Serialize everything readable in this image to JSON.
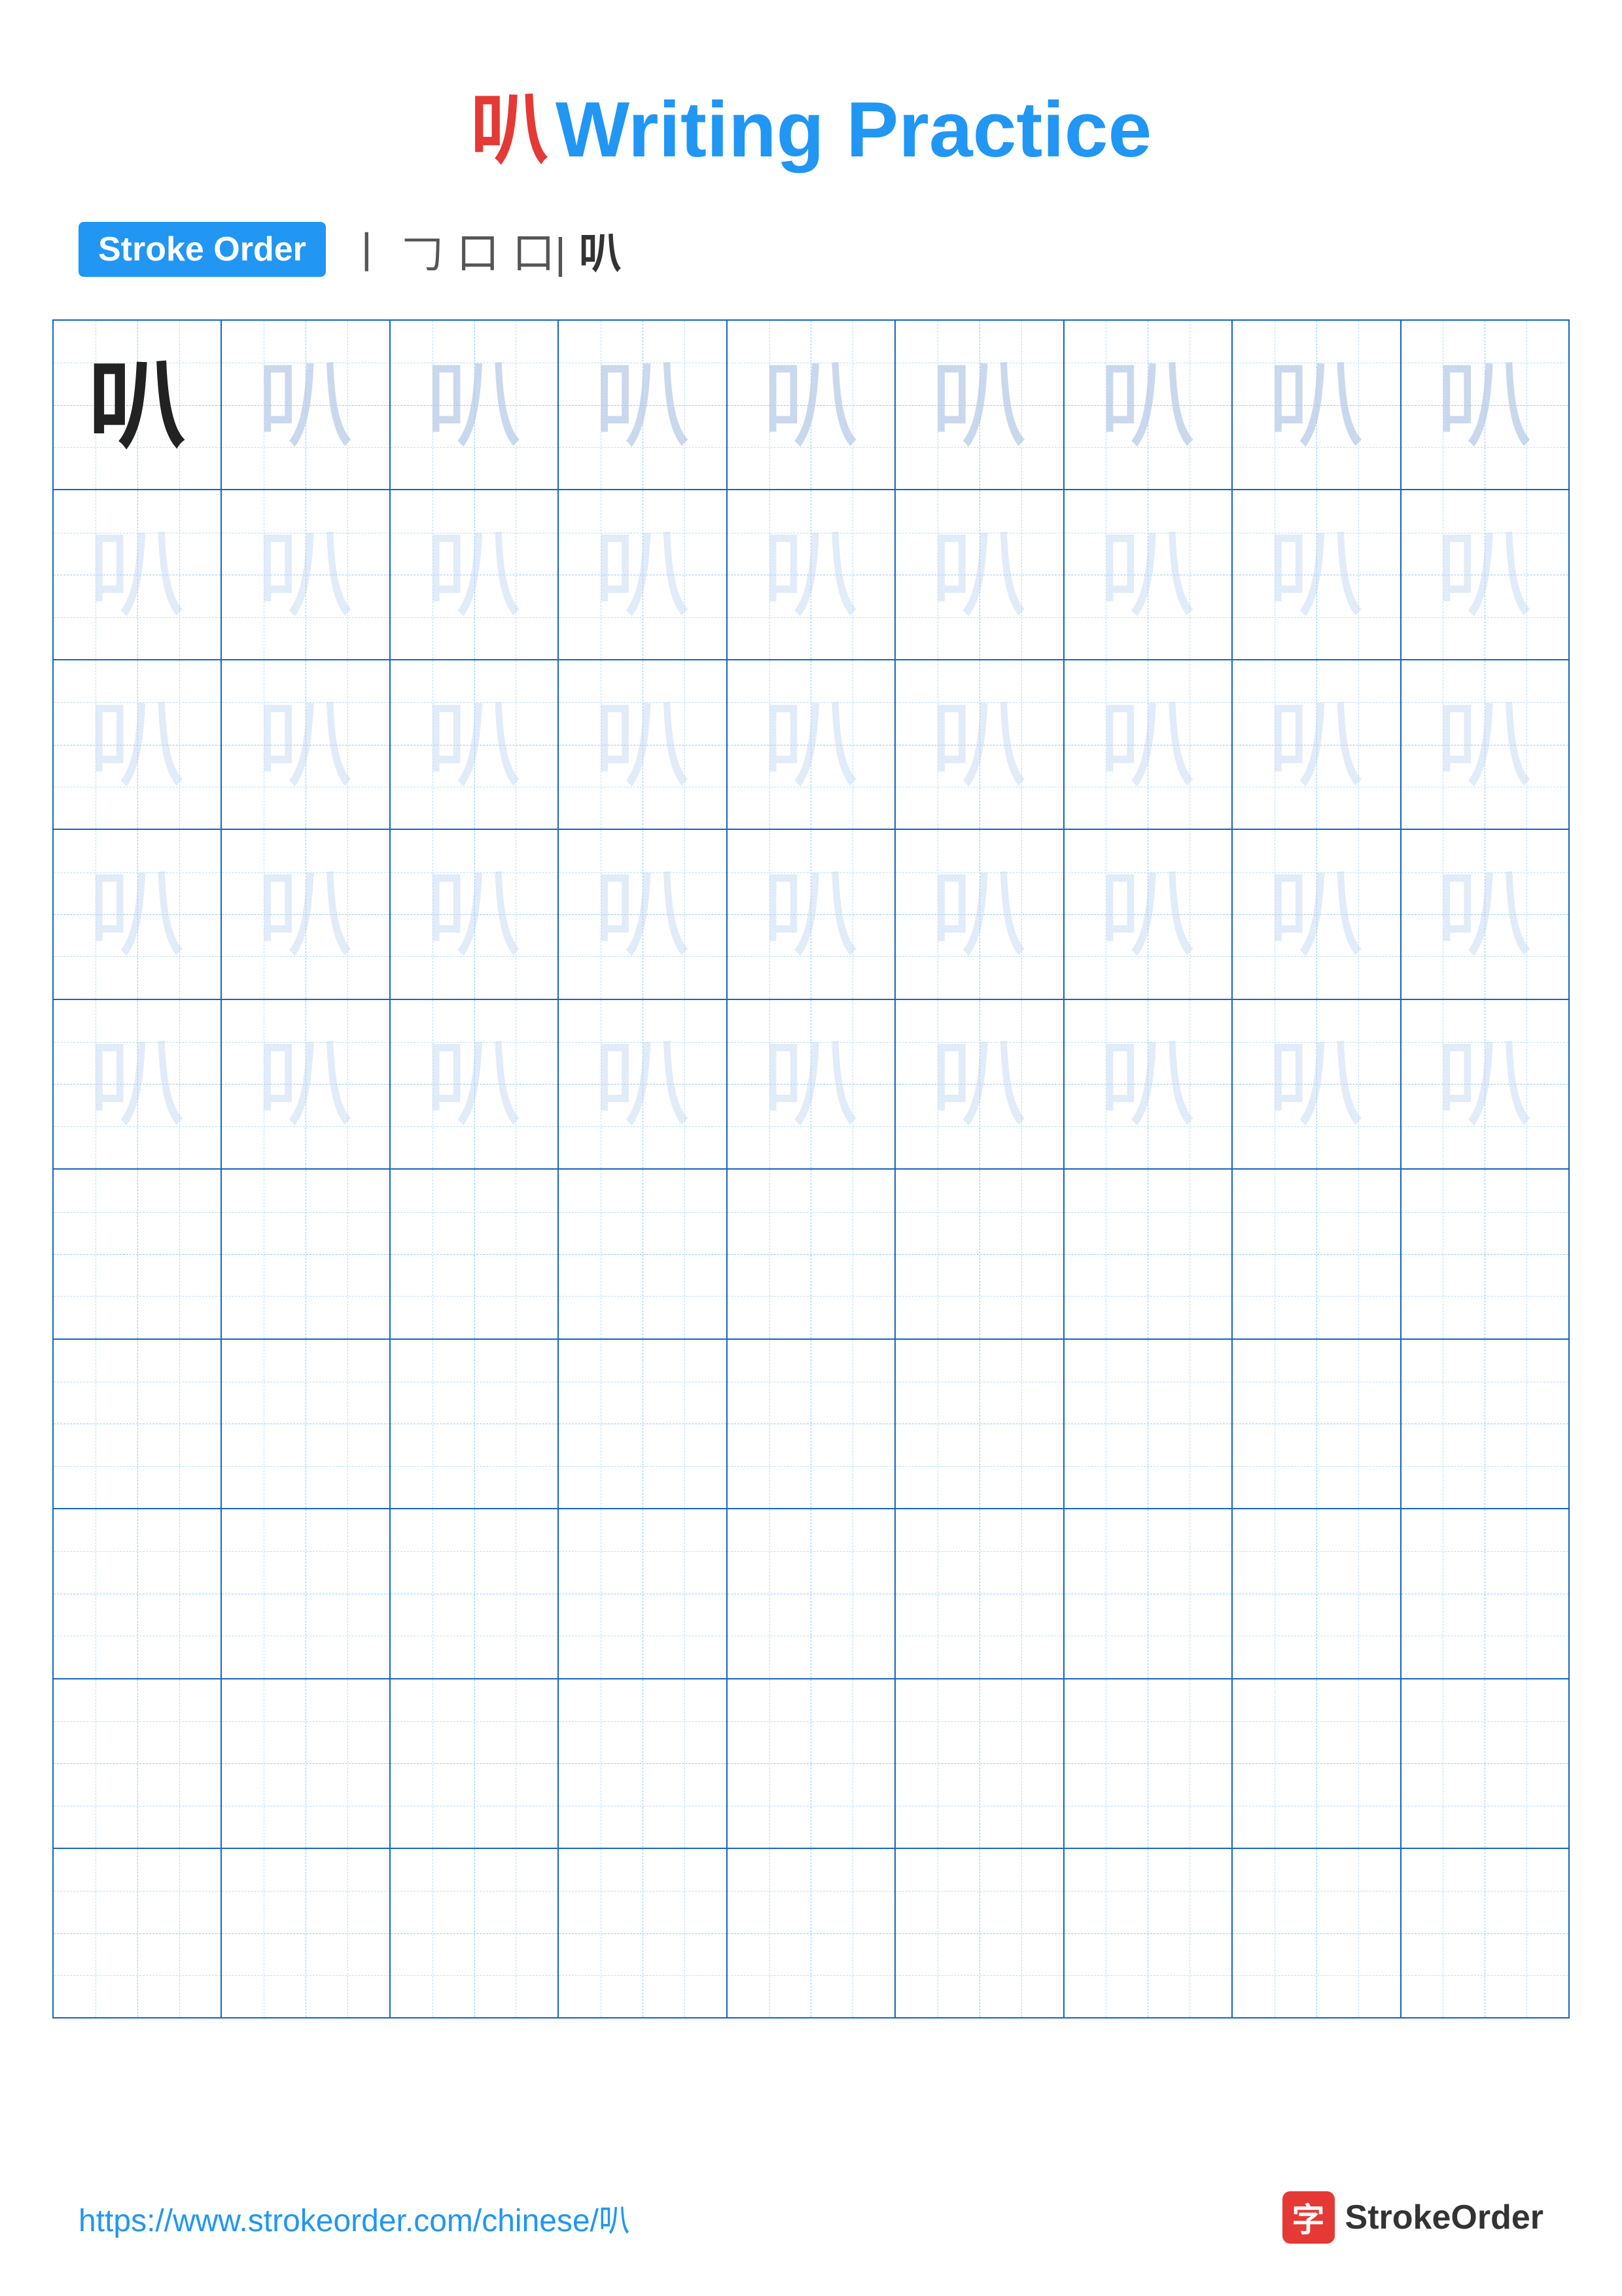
{
  "title": {
    "char": "叭",
    "label": "Writing Practice",
    "char_color": "#e53935",
    "text_color": "#2196F3"
  },
  "stroke_order": {
    "badge_label": "Stroke Order",
    "steps": [
      "丨",
      "𠃌",
      "口",
      "口|",
      "叭"
    ]
  },
  "grid": {
    "rows": 10,
    "cols": 9,
    "char": "叭",
    "guide_rows": 5,
    "empty_rows": 5
  },
  "footer": {
    "url": "https://www.strokeorder.com/chinese/叭",
    "logo_char": "字",
    "logo_label": "StrokeOrder"
  }
}
